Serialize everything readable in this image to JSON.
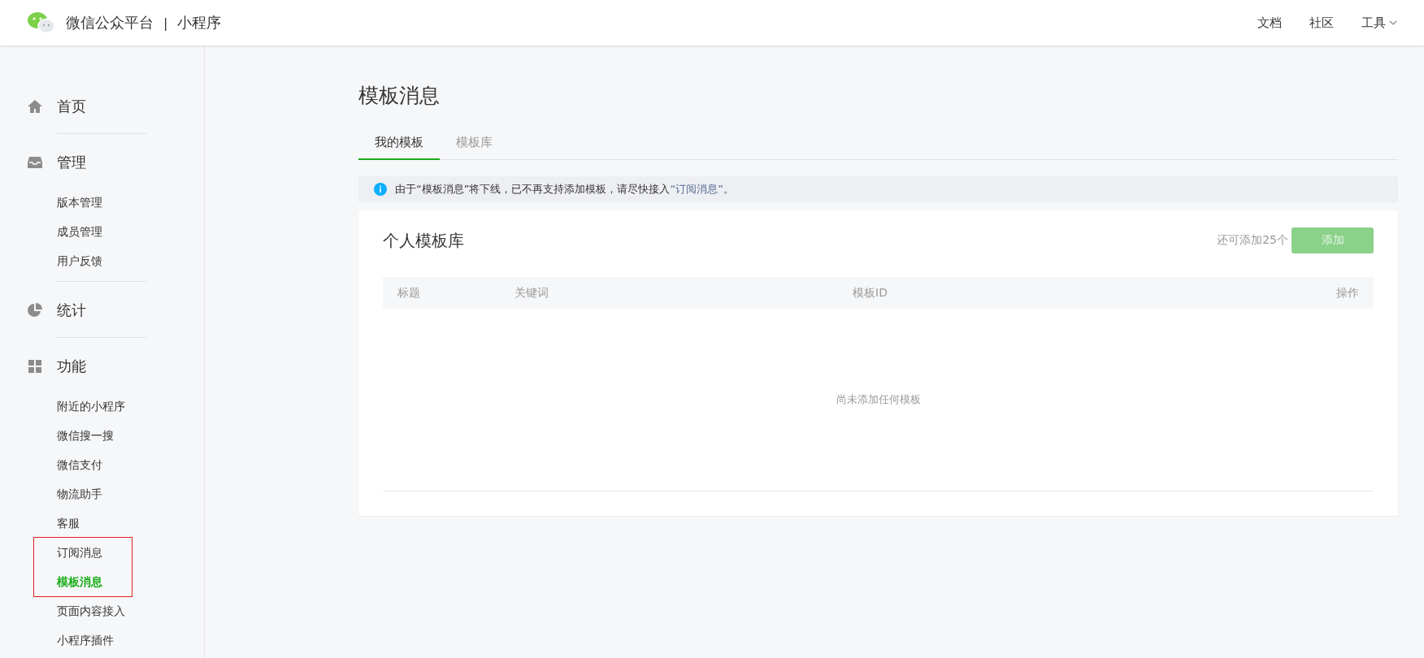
{
  "header": {
    "brand": "微信公众平台",
    "separator": "|",
    "product": "小程序",
    "nav": [
      {
        "label": "文档",
        "kind": "link"
      },
      {
        "label": "社区",
        "kind": "link"
      },
      {
        "label": "工具",
        "kind": "dropdown"
      }
    ]
  },
  "sidebar": {
    "sections": [
      {
        "label": "首页"
      },
      {
        "label": "管理",
        "items": [
          {
            "kind": "link",
            "label": "版本管理",
            "selected": false
          },
          {
            "kind": "link",
            "label": "成员管理",
            "selected": false
          },
          {
            "kind": "link",
            "label": "用户反馈",
            "selected": false
          }
        ]
      },
      {
        "label": "统计"
      },
      {
        "label": "功能",
        "items": [
          {
            "kind": "link",
            "label": "附近的小程序",
            "selected": false
          },
          {
            "kind": "link",
            "label": "微信搜一搜",
            "selected": false
          },
          {
            "kind": "link",
            "label": "微信支付",
            "selected": false
          },
          {
            "kind": "link",
            "label": "物流助手",
            "selected": false
          },
          {
            "kind": "link",
            "label": "客服",
            "selected": false
          },
          {
            "kind": "framed",
            "items": [
              {
                "label": "订阅消息",
                "selected": false
              },
              {
                "label": "模板消息",
                "selected": true
              }
            ]
          },
          {
            "kind": "link",
            "label": "页面内容接入",
            "selected": false
          },
          {
            "kind": "link",
            "label": "小程序插件",
            "selected": false
          }
        ]
      }
    ]
  },
  "page": {
    "title": "模板消息",
    "tabs": [
      {
        "label": "我的模板",
        "selected": true
      },
      {
        "label": "模板库",
        "selected": false
      }
    ],
    "notice": {
      "text": "由于“模板消息”将下线，已不再支持添加模板，请尽快接入",
      "link": "“订阅消息”",
      "suffix": "。"
    },
    "card": {
      "title": "个人模板库",
      "quota": "还可添加25个",
      "button": {
        "label": "添加",
        "disabled": true
      },
      "table": {
        "columns": [
          "标题",
          "关键词",
          "模板ID",
          "操作"
        ],
        "empty": "尚未添加任何模板"
      }
    }
  }
}
